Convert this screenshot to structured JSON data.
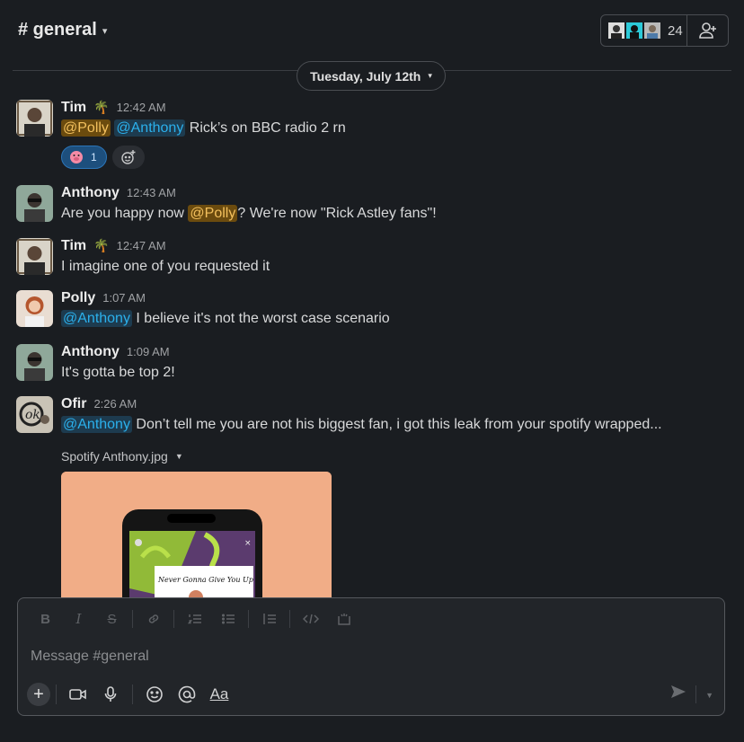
{
  "channel": {
    "name": "# general"
  },
  "members": {
    "count": "24"
  },
  "date_divider": {
    "label": "Tuesday, July 12th"
  },
  "messages": [
    {
      "name": "Tim",
      "emoji": "🌴",
      "time": "12:42 AM",
      "mention1": "@Polly",
      "mention2": "@Anthony",
      "text": " Rick’s on BBC radio 2 rn",
      "reaction_count": "1"
    },
    {
      "name": "Anthony",
      "time": "12:43 AM",
      "text_pre": "Are you happy now ",
      "mention": "@Polly",
      "text_post": "? We're now \"Rick Astley fans\"!"
    },
    {
      "name": "Tim",
      "emoji": "🌴",
      "time": "12:47 AM",
      "text": "I imagine one of you requested it"
    },
    {
      "name": "Polly",
      "time": "1:07 AM",
      "mention": "@Anthony",
      "text": " I believe it's not the worst case scenario"
    },
    {
      "name": "Anthony",
      "time": "1:09 AM",
      "text": "It's gotta be top 2!"
    },
    {
      "name": "Ofir",
      "time": "2:26 AM",
      "mention": "@Anthony",
      "text": " Don’t tell me you are not his biggest fan, i got this leak from your spotify wrapped..."
    }
  ],
  "attachment": {
    "filename": "Spotify Anthony.jpg",
    "song_text": "Never Gonna Give You Up"
  },
  "composer": {
    "placeholder": "Message #general",
    "format_label": "Aa"
  },
  "colors": {
    "background": "#1a1d21",
    "mention_me_bg": "#6b4b0e",
    "mention_other_bg": "#1d3b4f",
    "accent_blue": "#2bb0ec"
  }
}
